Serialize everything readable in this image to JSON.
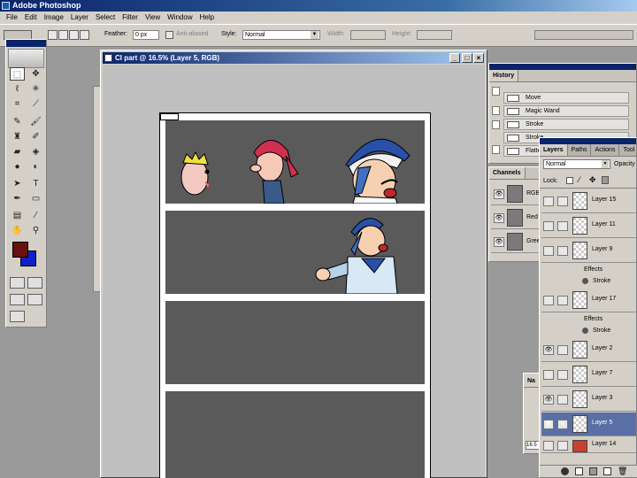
{
  "app": {
    "title": "Adobe Photoshop"
  },
  "menu": [
    "File",
    "Edit",
    "Image",
    "Layer",
    "Select",
    "Filter",
    "View",
    "Window",
    "Help"
  ],
  "options": {
    "feather_label": "Feather:",
    "feather_value": "0 px",
    "antialiased_label": "Anti-aliased",
    "style_label": "Style:",
    "style_value": "Normal",
    "width_label": "Width:",
    "height_label": "Height:"
  },
  "document": {
    "title": "CI part @ 16.5% (Layer 5, RGB)"
  },
  "history": {
    "tab": "History",
    "items": [
      "Move",
      "Magic Wand",
      "Stroke",
      "Stroke",
      "Flatten"
    ]
  },
  "channels": {
    "tab": "Channels",
    "items": [
      "RGB",
      "Red",
      "Green"
    ]
  },
  "navigator": {
    "tab": "Na",
    "zoom": "16.5"
  },
  "layers": {
    "tabs": [
      "Layers",
      "Paths",
      "Actions",
      "Tool Presets"
    ],
    "blend_mode": "Normal",
    "opacity_label": "Opacity",
    "lock_label": "Lock:",
    "rows": [
      {
        "type": "layer",
        "name": "Layer 15"
      },
      {
        "type": "layer",
        "name": "Layer 11"
      },
      {
        "type": "layer",
        "name": "Layer 9"
      },
      {
        "type": "effects",
        "name": "Effects"
      },
      {
        "type": "effect",
        "name": "Stroke"
      },
      {
        "type": "layer",
        "name": "Layer 17"
      },
      {
        "type": "effects",
        "name": "Effects"
      },
      {
        "type": "effect",
        "name": "Stroke"
      },
      {
        "type": "layer",
        "name": "Layer 2"
      },
      {
        "type": "layer",
        "name": "Layer 7"
      },
      {
        "type": "layer",
        "name": "Layer 3"
      },
      {
        "type": "layer",
        "name": "Layer 5",
        "selected": true
      },
      {
        "type": "layer",
        "name": "Layer 14"
      }
    ]
  },
  "colors": {
    "foreground": "#6b0f0f",
    "background": "#1020c8",
    "panel": "#5a5a5a"
  }
}
